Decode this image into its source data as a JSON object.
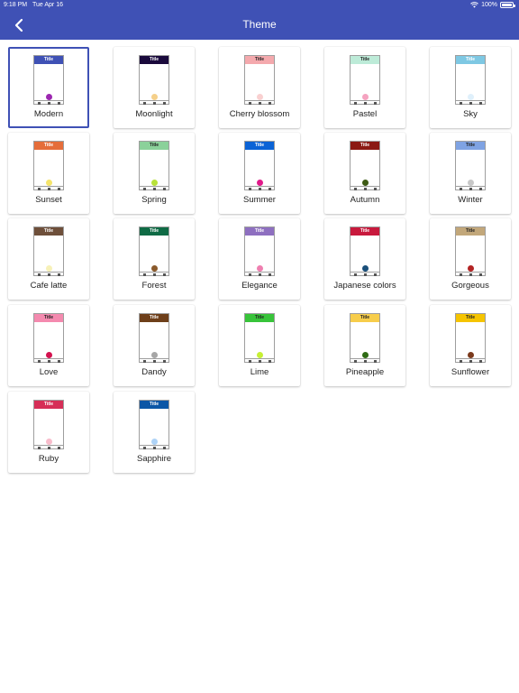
{
  "status": {
    "time": "9:18 PM",
    "date": "Tue Apr 16",
    "battery": "100%"
  },
  "header": {
    "title": "Theme",
    "back_icon": "chevron-left-icon"
  },
  "preview_bar_text": "Title",
  "selected_theme": "Modern",
  "themes": [
    {
      "name": "Modern",
      "bar": "#3f51b5",
      "text": "#ffffff",
      "fab": "#9c27b0"
    },
    {
      "name": "Moonlight",
      "bar": "#1a0a3c",
      "text": "#ffffff",
      "fab": "#f5d08a"
    },
    {
      "name": "Cherry blossom",
      "bar": "#f4a9ad",
      "text": "#222222",
      "fab": "#f9d0d0"
    },
    {
      "name": "Pastel",
      "bar": "#bdebd8",
      "text": "#222222",
      "fab": "#f5a3c0"
    },
    {
      "name": "Sky",
      "bar": "#7ec8e3",
      "text": "#ffffff",
      "fab": "#dff0fb"
    },
    {
      "name": "Sunset",
      "bar": "#e56d3a",
      "text": "#ffffff",
      "fab": "#f5e46a"
    },
    {
      "name": "Spring",
      "bar": "#8bd19a",
      "text": "#222222",
      "fab": "#b8e23a"
    },
    {
      "name": "Summer",
      "bar": "#0b63d6",
      "text": "#ffffff",
      "fab": "#e0198a"
    },
    {
      "name": "Autumn",
      "bar": "#8b1a14",
      "text": "#ffffff",
      "fab": "#3d5a14"
    },
    {
      "name": "Winter",
      "bar": "#7fa3e3",
      "text": "#222222",
      "fab": "#c7c7c7"
    },
    {
      "name": "Cafe latte",
      "bar": "#6e4f3a",
      "text": "#ffffff",
      "fab": "#f7f1b8"
    },
    {
      "name": "Forest",
      "bar": "#0f6b45",
      "text": "#ffffff",
      "fab": "#8a5a2c"
    },
    {
      "name": "Elegance",
      "bar": "#8e6fc0",
      "text": "#ffffff",
      "fab": "#ef7fb0"
    },
    {
      "name": "Japanese colors",
      "bar": "#c8193d",
      "text": "#ffffff",
      "fab": "#1a4f7a"
    },
    {
      "name": "Gorgeous",
      "bar": "#c2a77a",
      "text": "#222222",
      "fab": "#b32424"
    },
    {
      "name": "Love",
      "bar": "#f48aaf",
      "text": "#222222",
      "fab": "#d3124f"
    },
    {
      "name": "Dandy",
      "bar": "#6e3f1a",
      "text": "#ffffff",
      "fab": "#a6a6a6"
    },
    {
      "name": "Lime",
      "bar": "#38c43a",
      "text": "#222222",
      "fab": "#c6f034"
    },
    {
      "name": "Pineapple",
      "bar": "#f7cd4b",
      "text": "#222222",
      "fab": "#2f6b14"
    },
    {
      "name": "Sunflower",
      "bar": "#f5c400",
      "text": "#222222",
      "fab": "#7b3a1c"
    },
    {
      "name": "Ruby",
      "bar": "#d62e57",
      "text": "#ffffff",
      "fab": "#f8bccb"
    },
    {
      "name": "Sapphire",
      "bar": "#0b56a6",
      "text": "#ffffff",
      "fab": "#aed3f7"
    }
  ]
}
